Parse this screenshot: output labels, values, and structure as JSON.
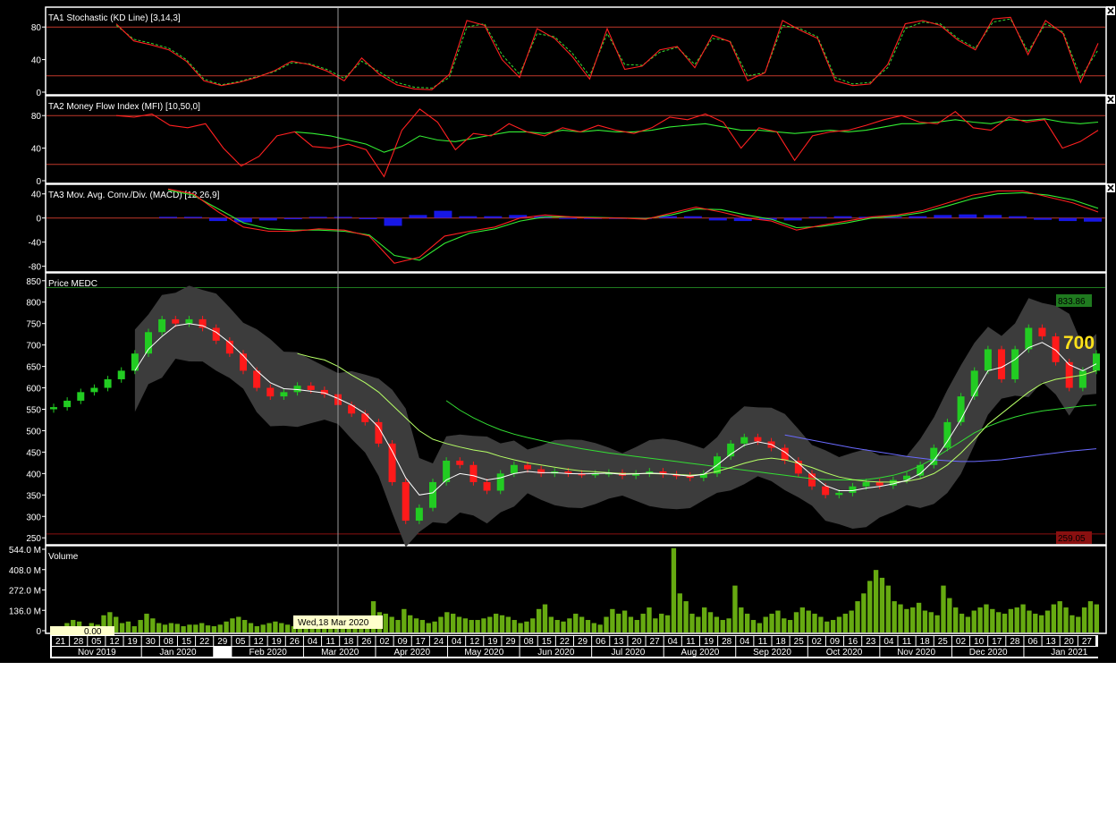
{
  "colors": {
    "background": "#000000",
    "panel_border": "#ffffff",
    "ref_line": "#c0392b",
    "stoch_k": "#ff2020",
    "stoch_d": "#33dd33",
    "mfi": "#ff2020",
    "mfi_signal": "#33ee33",
    "macd": "#ff2020",
    "macd_signal": "#33ee33",
    "histogram": "#1a1aff",
    "candle_up": "#22cc22",
    "candle_down": "#ff1a1a",
    "bollinger_fill": "#3c3c3c",
    "ma_short": "#ffffff",
    "ma_mid": "#b6ff66",
    "ma_long": "#33dd33",
    "ma_xlong": "#6a6aff",
    "volume_bar": "#66aa11",
    "high_label_bg": "#1f7a1f",
    "low_label_bg": "#8a1010",
    "last_price": "#ffe21a",
    "crosshair": "#aaaaaa"
  },
  "icons": {
    "close": "close-icon"
  },
  "chart_data": [
    {
      "type": "line",
      "panel": "stochastic",
      "title": "TA1 Stochastic (KD Line) [3,14,3]",
      "ylim": [
        0,
        100
      ],
      "yticks": [
        "0",
        "40",
        "80"
      ],
      "reference_lines": [
        20,
        80
      ],
      "series": [
        {
          "name": "K",
          "values": [
            84,
            63,
            58,
            52,
            38,
            14,
            8,
            12,
            18,
            26,
            38,
            34,
            26,
            14,
            42,
            22,
            9,
            4,
            3,
            22,
            88,
            82,
            40,
            18,
            78,
            66,
            44,
            16,
            78,
            28,
            32,
            52,
            56,
            30,
            70,
            62,
            14,
            24,
            88,
            76,
            66,
            14,
            8,
            10,
            34,
            84,
            88,
            82,
            64,
            52,
            90,
            92,
            46,
            88,
            72,
            12,
            60
          ]
        },
        {
          "name": "D",
          "values": [
            82,
            65,
            60,
            54,
            40,
            16,
            9,
            13,
            19,
            25,
            36,
            35,
            28,
            17,
            38,
            25,
            12,
            6,
            5,
            18,
            80,
            84,
            46,
            22,
            72,
            68,
            48,
            20,
            72,
            34,
            33,
            49,
            55,
            34,
            66,
            63,
            20,
            24,
            82,
            78,
            68,
            18,
            10,
            12,
            30,
            78,
            86,
            84,
            66,
            54,
            86,
            90,
            50,
            84,
            74,
            18,
            52
          ]
        }
      ]
    },
    {
      "type": "line",
      "panel": "mfi",
      "title": "TA2 Money Flow Index (MFI) [10,50,0]",
      "ylim": [
        0,
        100
      ],
      "yticks": [
        "0",
        "40",
        "80"
      ],
      "reference_lines": [
        20,
        80
      ],
      "series": [
        {
          "name": "MFI",
          "values": [
            80,
            78,
            82,
            68,
            65,
            70,
            40,
            18,
            30,
            55,
            60,
            42,
            40,
            45,
            38,
            5,
            62,
            88,
            72,
            38,
            58,
            55,
            70,
            60,
            55,
            65,
            60,
            68,
            62,
            58,
            65,
            78,
            75,
            82,
            72,
            40,
            65,
            60,
            25,
            55,
            60,
            62,
            68,
            75,
            80,
            72,
            70,
            85,
            65,
            62,
            78,
            72,
            75,
            40,
            48,
            62
          ]
        },
        {
          "name": "MFI average",
          "values": [
            null,
            null,
            null,
            null,
            null,
            null,
            null,
            null,
            null,
            null,
            60,
            58,
            55,
            50,
            45,
            35,
            42,
            55,
            50,
            48,
            52,
            56,
            60,
            60,
            58,
            62,
            60,
            62,
            60,
            60,
            62,
            66,
            68,
            70,
            66,
            62,
            62,
            60,
            58,
            60,
            62,
            60,
            62,
            66,
            70,
            70,
            72,
            75,
            72,
            70,
            75,
            74,
            76,
            72,
            70,
            72
          ]
        }
      ]
    },
    {
      "type": "line",
      "panel": "macd",
      "title": "TA3 Mov. Avg. Conv./Div. (MACD) [12,26,9]",
      "ylim": [
        -85,
        50
      ],
      "yticks": [
        "-80",
        "-40",
        "0",
        "40"
      ],
      "reference_lines": [
        0
      ],
      "series": [
        {
          "name": "MACD",
          "values": [
            48,
            40,
            10,
            -15,
            -22,
            -22,
            -18,
            -20,
            -30,
            -75,
            -65,
            -30,
            -22,
            -15,
            0,
            5,
            2,
            0,
            0,
            -2,
            8,
            18,
            10,
            0,
            -5,
            -20,
            -12,
            -5,
            2,
            5,
            12,
            25,
            38,
            45,
            45,
            35,
            25,
            10
          ]
        },
        {
          "name": "Signal",
          "values": [
            46,
            38,
            15,
            -8,
            -18,
            -20,
            -20,
            -22,
            -28,
            -62,
            -70,
            -42,
            -25,
            -18,
            -5,
            2,
            2,
            1,
            0,
            -1,
            5,
            15,
            14,
            5,
            -2,
            -16,
            -14,
            -8,
            0,
            3,
            9,
            20,
            32,
            40,
            42,
            38,
            30,
            16
          ]
        },
        {
          "name": "Histogram",
          "values": [
            2,
            2,
            -5,
            -7,
            -4,
            -2,
            2,
            2,
            -2,
            -13,
            5,
            12,
            3,
            3,
            5,
            3,
            0,
            -1,
            0,
            -1,
            3,
            3,
            -4,
            -5,
            -3,
            -4,
            2,
            3,
            2,
            2,
            3,
            5,
            6,
            5,
            3,
            -3,
            -5,
            -6
          ]
        }
      ]
    },
    {
      "type": "candlestick",
      "panel": "price",
      "title": "Price MEDC",
      "ylim": [
        240,
        860
      ],
      "yticks": [
        "250",
        "300",
        "350",
        "400",
        "450",
        "500",
        "550",
        "600",
        "650",
        "700",
        "750",
        "800",
        "850"
      ],
      "high_marker": "833.86",
      "low_marker": "259.05",
      "last_price": "700",
      "ohlc_close": [
        555,
        570,
        590,
        600,
        620,
        640,
        680,
        730,
        760,
        750,
        760,
        740,
        710,
        680,
        640,
        600,
        580,
        590,
        605,
        595,
        585,
        560,
        540,
        520,
        470,
        380,
        290,
        320,
        380,
        430,
        420,
        380,
        360,
        400,
        420,
        410,
        400,
        405,
        400,
        398,
        400,
        402,
        395,
        400,
        405,
        398,
        395,
        390,
        400,
        440,
        470,
        485,
        475,
        460,
        430,
        400,
        370,
        350,
        355,
        370,
        380,
        372,
        385,
        395,
        420,
        460,
        520,
        580,
        640,
        690,
        620,
        690,
        740,
        720,
        660,
        600,
        640,
        680
      ],
      "series": [
        {
          "name": "MA short",
          "values": [
            null,
            null,
            null,
            null,
            null,
            null,
            640,
            690,
            720,
            745,
            750,
            745,
            730,
            705,
            675,
            640,
            612,
            598,
            596,
            592,
            588,
            575,
            560,
            540,
            508,
            452,
            390,
            350,
            355,
            385,
            400,
            395,
            385,
            390,
            400,
            405,
            402,
            402,
            400,
            399,
            400,
            401,
            398,
            399,
            401,
            400,
            397,
            394,
            398,
            420,
            445,
            466,
            474,
            468,
            450,
            424,
            396,
            372,
            360,
            360,
            366,
            370,
            376,
            384,
            400,
            430,
            475,
            526,
            586,
            640,
            648,
            666,
            694,
            706,
            688,
            654,
            640,
            656
          ]
        },
        {
          "name": "MA mid",
          "values": [
            null,
            null,
            null,
            null,
            null,
            null,
            null,
            null,
            null,
            null,
            null,
            null,
            null,
            null,
            null,
            null,
            null,
            null,
            680,
            672,
            665,
            650,
            630,
            612,
            590,
            560,
            530,
            500,
            480,
            470,
            462,
            455,
            450,
            440,
            432,
            425,
            420,
            415,
            410,
            406,
            404,
            402,
            400,
            400,
            400,
            399,
            398,
            396,
            398,
            405,
            414,
            424,
            432,
            436,
            432,
            424,
            414,
            402,
            392,
            386,
            382,
            380,
            380,
            382,
            388,
            400,
            420,
            448,
            480,
            515,
            540,
            565,
            590,
            610,
            620,
            625,
            630,
            640
          ]
        },
        {
          "name": "MA long",
          "values": [
            null,
            null,
            null,
            null,
            null,
            null,
            null,
            null,
            null,
            null,
            null,
            null,
            null,
            null,
            null,
            null,
            null,
            null,
            null,
            null,
            null,
            null,
            null,
            null,
            null,
            null,
            null,
            null,
            null,
            570,
            548,
            530,
            515,
            502,
            492,
            484,
            477,
            470,
            464,
            458,
            453,
            448,
            444,
            440,
            436,
            432,
            428,
            424,
            420,
            416,
            412,
            408,
            404,
            400,
            396,
            392,
            388,
            386,
            385,
            385,
            386,
            390,
            396,
            405,
            418,
            435,
            455,
            475,
            495,
            510,
            522,
            532,
            540,
            546,
            550,
            554,
            558,
            560
          ]
        },
        {
          "name": "MA extra long",
          "values": [
            null,
            null,
            null,
            null,
            null,
            null,
            null,
            null,
            null,
            null,
            null,
            null,
            null,
            null,
            null,
            null,
            null,
            null,
            null,
            null,
            null,
            null,
            null,
            null,
            null,
            null,
            null,
            null,
            null,
            null,
            null,
            null,
            null,
            null,
            null,
            null,
            null,
            null,
            null,
            null,
            null,
            null,
            null,
            null,
            null,
            null,
            null,
            null,
            null,
            null,
            null,
            null,
            null,
            null,
            490,
            484,
            478,
            472,
            466,
            460,
            455,
            450,
            445,
            440,
            436,
            432,
            430,
            428,
            428,
            430,
            432,
            436,
            440,
            444,
            448,
            452,
            455,
            458
          ]
        }
      ]
    },
    {
      "type": "bar",
      "panel": "volume",
      "title": "Volume",
      "ylim": [
        0,
        544
      ],
      "yticks": [
        "0",
        "136.0 M",
        "272.0 M",
        "408.0 M",
        "544.0 M"
      ],
      "cursor_value": "0.00",
      "values": [
        20,
        40,
        60,
        80,
        70,
        40,
        60,
        50,
        110,
        130,
        100,
        60,
        70,
        40,
        80,
        120,
        90,
        60,
        50,
        60,
        55,
        40,
        50,
        50,
        60,
        45,
        40,
        50,
        70,
        90,
        100,
        80,
        60,
        40,
        50,
        60,
        70,
        60,
        50,
        40,
        45,
        50,
        60,
        80,
        100,
        70,
        60,
        50,
        40,
        50,
        80,
        90,
        200,
        130,
        120,
        100,
        80,
        150,
        110,
        90,
        80,
        60,
        70,
        100,
        130,
        120,
        100,
        90,
        80,
        80,
        90,
        100,
        120,
        110,
        100,
        80,
        60,
        70,
        90,
        150,
        180,
        100,
        80,
        70,
        90,
        120,
        100,
        80,
        60,
        50,
        100,
        150,
        120,
        140,
        100,
        80,
        120,
        160,
        90,
        120,
        110,
        540,
        250,
        200,
        120,
        100,
        160,
        130,
        100,
        80,
        90,
        300,
        160,
        120,
        80,
        60,
        100,
        120,
        140,
        90,
        80,
        130,
        160,
        140,
        120,
        100,
        70,
        80,
        100,
        120,
        140,
        200,
        250,
        330,
        400,
        350,
        300,
        200,
        180,
        150,
        160,
        190,
        140,
        130,
        110,
        300,
        220,
        160,
        120,
        100,
        140,
        160,
        180,
        150,
        130,
        120,
        150,
        160,
        180,
        140,
        120,
        110,
        140,
        180,
        200,
        160,
        110,
        100,
        160,
        200,
        180
      ]
    }
  ],
  "crosshair_label": "Wed,18 Mar 2020",
  "x_axis": {
    "days": [
      "21",
      "28",
      "05",
      "12",
      "19",
      "30",
      "08",
      "15",
      "22",
      "29",
      "05",
      "12",
      "19",
      "26",
      "04",
      "11",
      "18",
      "26",
      "02",
      "09",
      "17",
      "24",
      "04",
      "12",
      "19",
      "29",
      "08",
      "15",
      "22",
      "29",
      "06",
      "13",
      "20",
      "27",
      "04",
      "11",
      "19",
      "28",
      "04",
      "11",
      "18",
      "25",
      "02",
      "09",
      "16",
      "23",
      "04",
      "11",
      "18",
      "25",
      "02",
      "10",
      "17",
      "28",
      "06",
      "13",
      "20",
      "27"
    ],
    "months": [
      "Nov 2019",
      "Jan 2020",
      "Feb 2020",
      "Mar 2020",
      "Apr 2020",
      "May 2020",
      "Jun 2020",
      "Jul 2020",
      "Aug 2020",
      "Sep 2020",
      "Oct 2020",
      "Nov 2020",
      "Dec 2020",
      "Jan 2021"
    ]
  }
}
